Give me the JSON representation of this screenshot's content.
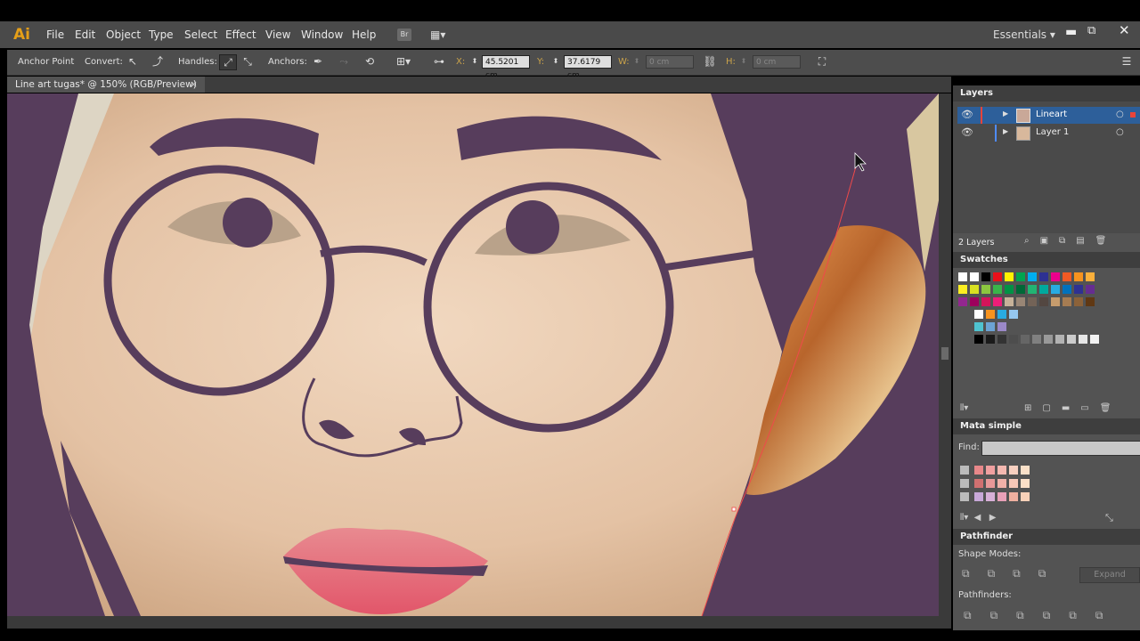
{
  "app": {
    "logo": "Ai",
    "menu": [
      "File",
      "Edit",
      "Object",
      "Type",
      "Select",
      "Effect",
      "View",
      "Window",
      "Help"
    ],
    "workspace": "Essentials",
    "bridge": "Br"
  },
  "control_bar": {
    "tool_label": "Anchor Point",
    "convert_label": "Convert:",
    "handles_label": "Handles:",
    "anchors_label": "Anchors:",
    "x_label": "X:",
    "x_value": "45.5201 cm",
    "y_label": "Y:",
    "y_value": "37.6179 cm",
    "w_label": "W:",
    "w_value": "0 cm",
    "h_label": "H:",
    "h_value": "0 cm"
  },
  "document": {
    "tab_title": "Line art tugas* @ 150% (RGB/Preview)",
    "close": "×"
  },
  "layers_panel": {
    "title": "Layers",
    "layers": [
      {
        "name": "Lineart",
        "color": "#e8443a"
      },
      {
        "name": "Layer 1",
        "color": "#4f8cff"
      }
    ],
    "count": "2 Layers"
  },
  "swatches_panel": {
    "title": "Swatches"
  },
  "mata_panel": {
    "title": "Mata simple",
    "find_label": "Find:"
  },
  "pathfinder_panel": {
    "title": "Pathfinder",
    "shape_modes": "Shape Modes:",
    "expand": "Expand",
    "pathfinders": "Pathfinders:"
  },
  "colors": {
    "lineart": "#573d5c",
    "skin": "#e8c9ad",
    "ui_dark": "#4a4a4a",
    "accent": "#e59f18"
  }
}
